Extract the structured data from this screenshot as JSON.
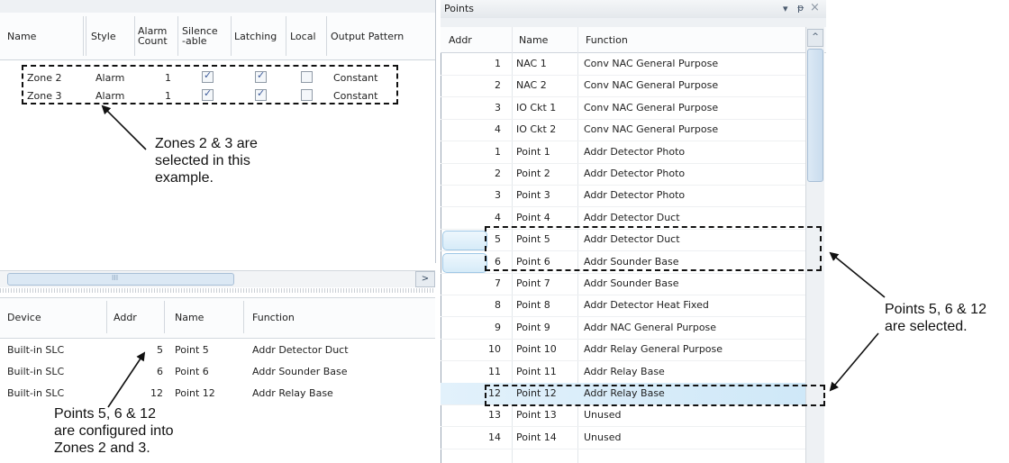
{
  "zones_table": {
    "headers": [
      "Name",
      "Style",
      "Alarm Count",
      "Silence -able",
      "Latching",
      "Local",
      "Output Pattern"
    ],
    "rows": [
      {
        "name": "Zone 2",
        "style": "Alarm",
        "alarm_count": "1",
        "silenceable": true,
        "latching": true,
        "local": false,
        "output_pattern": "Constant"
      },
      {
        "name": "Zone 3",
        "style": "Alarm",
        "alarm_count": "1",
        "silenceable": true,
        "latching": true,
        "local": false,
        "output_pattern": "Constant"
      }
    ],
    "scroll_grip": "III",
    "scroll_right_arrow": ">"
  },
  "devices_table": {
    "headers": [
      "Device",
      "Addr",
      "Name",
      "Function"
    ],
    "rows": [
      {
        "device": "Built-in SLC",
        "addr": "5",
        "name": "Point 5",
        "function": "Addr Detector Duct"
      },
      {
        "device": "Built-in SLC",
        "addr": "6",
        "name": "Point 6",
        "function": "Addr Sounder Base"
      },
      {
        "device": "Built-in SLC",
        "addr": "12",
        "name": "Point 12",
        "function": "Addr Relay Base"
      }
    ]
  },
  "points_panel": {
    "title": "Points",
    "title_buttons": {
      "menu": "▾",
      "pin": "ᵽ",
      "close": "×"
    },
    "headers": [
      "Addr",
      "Name",
      "Function"
    ],
    "scroll_up_arrow": "^",
    "selected_addrs_index": [
      9,
      10,
      15
    ],
    "rows": [
      {
        "addr": "1",
        "name": "NAC 1",
        "function": "Conv NAC General Purpose"
      },
      {
        "addr": "2",
        "name": "NAC 2",
        "function": "Conv NAC General Purpose"
      },
      {
        "addr": "3",
        "name": "IO Ckt 1",
        "function": "Conv NAC General Purpose"
      },
      {
        "addr": "4",
        "name": "IO Ckt 2",
        "function": "Conv NAC General Purpose"
      },
      {
        "addr": "1",
        "name": "Point 1",
        "function": "Addr Detector Photo"
      },
      {
        "addr": "2",
        "name": "Point 2",
        "function": "Addr Detector Photo"
      },
      {
        "addr": "3",
        "name": "Point 3",
        "function": "Addr Detector Photo"
      },
      {
        "addr": "4",
        "name": "Point 4",
        "function": "Addr Detector Duct"
      },
      {
        "addr": "5",
        "name": "Point 5",
        "function": "Addr Detector Duct"
      },
      {
        "addr": "6",
        "name": "Point 6",
        "function": "Addr Sounder Base"
      },
      {
        "addr": "7",
        "name": "Point 7",
        "function": "Addr Sounder Base"
      },
      {
        "addr": "8",
        "name": "Point 8",
        "function": "Addr Detector Heat Fixed"
      },
      {
        "addr": "9",
        "name": "Point 9",
        "function": "Addr NAC General Purpose"
      },
      {
        "addr": "10",
        "name": "Point 10",
        "function": "Addr Relay General Purpose"
      },
      {
        "addr": "11",
        "name": "Point 11",
        "function": "Addr Relay Base"
      },
      {
        "addr": "12",
        "name": "Point 12",
        "function": "Addr Relay Base"
      },
      {
        "addr": "13",
        "name": "Point 13",
        "function": "Unused"
      },
      {
        "addr": "14",
        "name": "Point 14",
        "function": "Unused"
      }
    ]
  },
  "annotations": {
    "zones_selected": [
      "Zones 2 & 3 are",
      "selected in this",
      "example."
    ],
    "points_configured": [
      "Points 5, 6 & 12",
      "are configured into",
      "Zones 2 and 3."
    ],
    "points_selected": [
      "Points 5, 6 & 12",
      "are selected."
    ]
  }
}
